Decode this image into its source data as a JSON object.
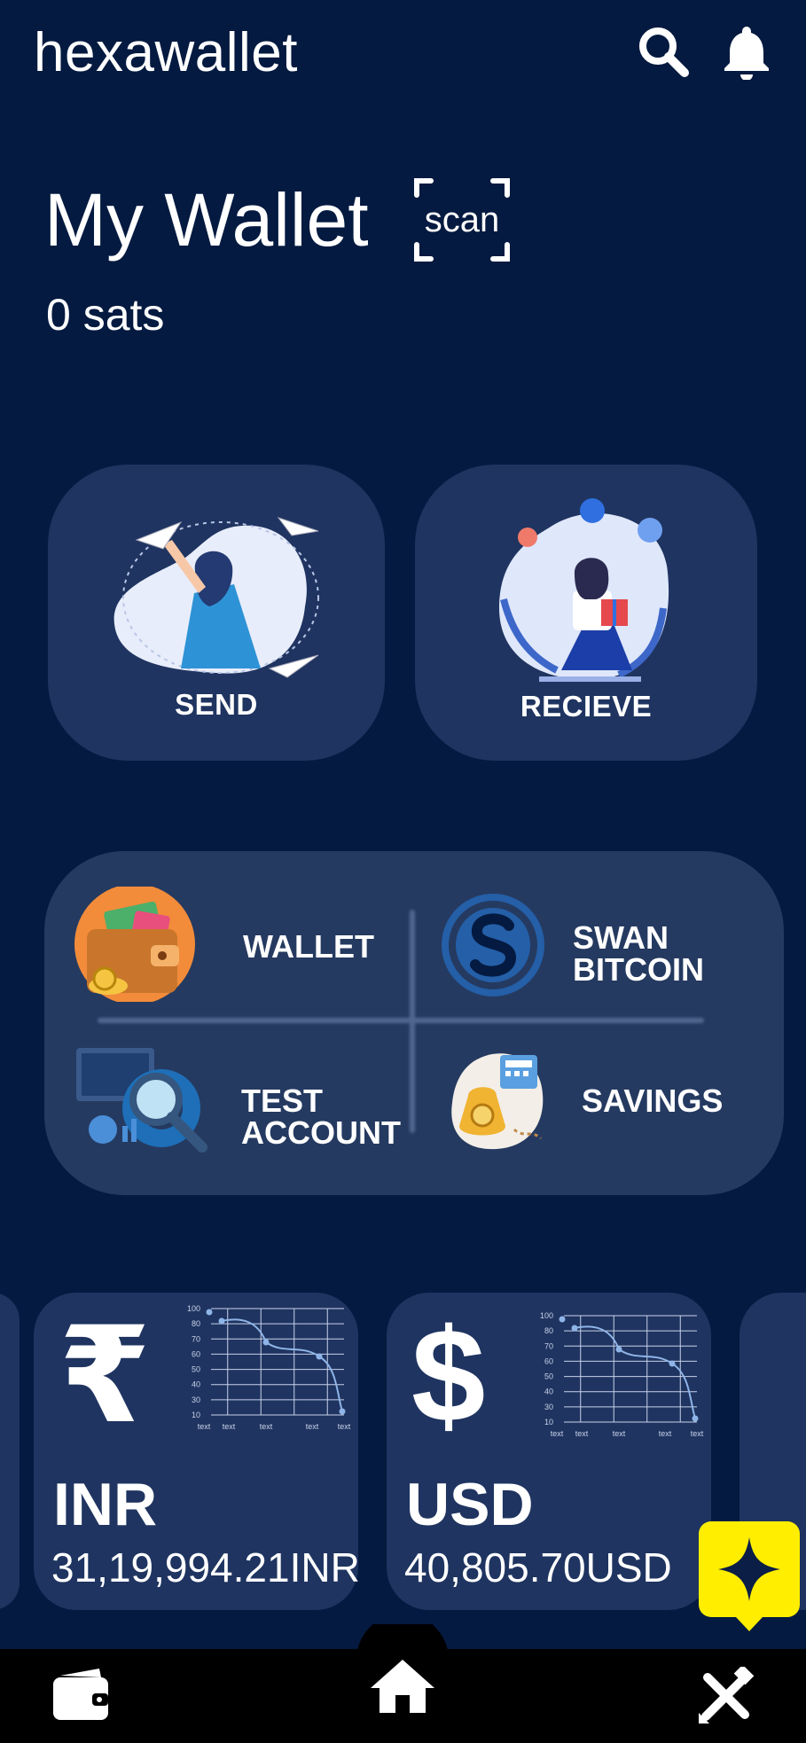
{
  "header": {
    "app_title": "hexawallet",
    "search_icon": "search-icon",
    "notification_icon": "bell-icon"
  },
  "wallet": {
    "title": "My Wallet",
    "scan_label": "scan",
    "balance": "0 sats"
  },
  "actions": [
    {
      "label": "SEND",
      "illustration": "woman-throwing-paper-plane"
    },
    {
      "label": "RECIEVE",
      "illustration": "girl-with-gift-and-balloons"
    }
  ],
  "accounts": [
    {
      "label": "WALLET",
      "icon": "wallet-icon"
    },
    {
      "label": "SWAN\nBITCOIN",
      "line1": "SWAN",
      "line2": "BITCOIN",
      "icon": "swan-logo-icon"
    },
    {
      "label": "TEST\nACCOUNT",
      "line1": "TEST",
      "line2": "ACCOUNT",
      "icon": "gear-magnifier-icon"
    },
    {
      "label": "SAVINGS",
      "icon": "money-bag-icon"
    }
  ],
  "currencies": [
    {
      "code": "INR",
      "symbol": "₹",
      "amount": "31,19,994.21INR",
      "chart_ticks": [
        "100",
        "80",
        "70",
        "60",
        "50",
        "40",
        "30",
        "10"
      ],
      "chart_xlabels": [
        "text",
        "text",
        "text",
        "text",
        "text"
      ]
    },
    {
      "code": "USD",
      "symbol": "$",
      "amount": "40,805.70USD",
      "chart_ticks": [
        "100",
        "80",
        "70",
        "60",
        "50",
        "40",
        "30",
        "10"
      ],
      "chart_xlabels": [
        "text",
        "text",
        "text",
        "text",
        "text"
      ]
    }
  ],
  "assistant": {
    "icon": "sparkle-icon"
  },
  "bottom_nav": [
    {
      "icon": "wallet-icon"
    },
    {
      "icon": "home-icon"
    },
    {
      "icon": "tools-icon"
    }
  ],
  "colors": {
    "background": "#041a40",
    "card": "#1f3460",
    "panel": "#253a60",
    "accent": "#ffee00",
    "nav": "#000000"
  }
}
